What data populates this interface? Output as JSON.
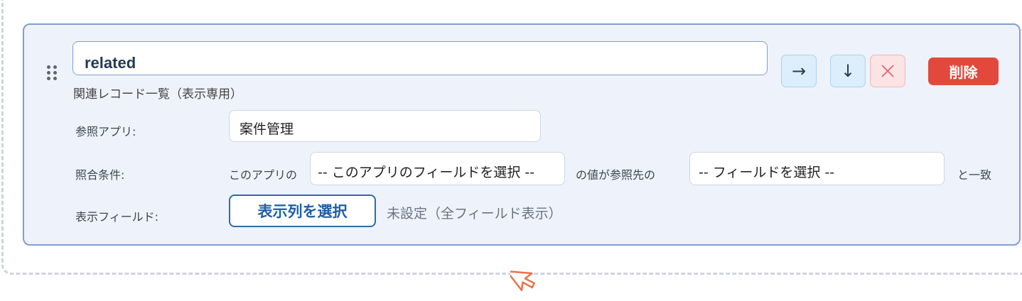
{
  "field": {
    "name": "related",
    "type_label": "関連レコード一覧（表示専用）"
  },
  "actions": {
    "move_right_icon": "→",
    "move_down_icon": "↓",
    "remove_icon": "×",
    "delete_label": "削除"
  },
  "ref_app": {
    "label": "参照アプリ:",
    "value": "案件管理"
  },
  "match": {
    "label": "照合条件:",
    "prefix": "このアプリの",
    "this_field_select": "-- このアプリのフィールドを選択 --",
    "middle": "の値が参照先の",
    "target_field_select": "-- フィールドを選択 --",
    "suffix": "と一致"
  },
  "display": {
    "label": "表示フィールド:",
    "button_label": "表示列を選択",
    "status": "未設定（全フィールド表示）"
  },
  "colors": {
    "card_bg": "#eef3fb",
    "card_border": "#7e9fd6",
    "delete": "#e2493c",
    "primary": "#2b6cb0",
    "cursor": "#e8734a"
  }
}
